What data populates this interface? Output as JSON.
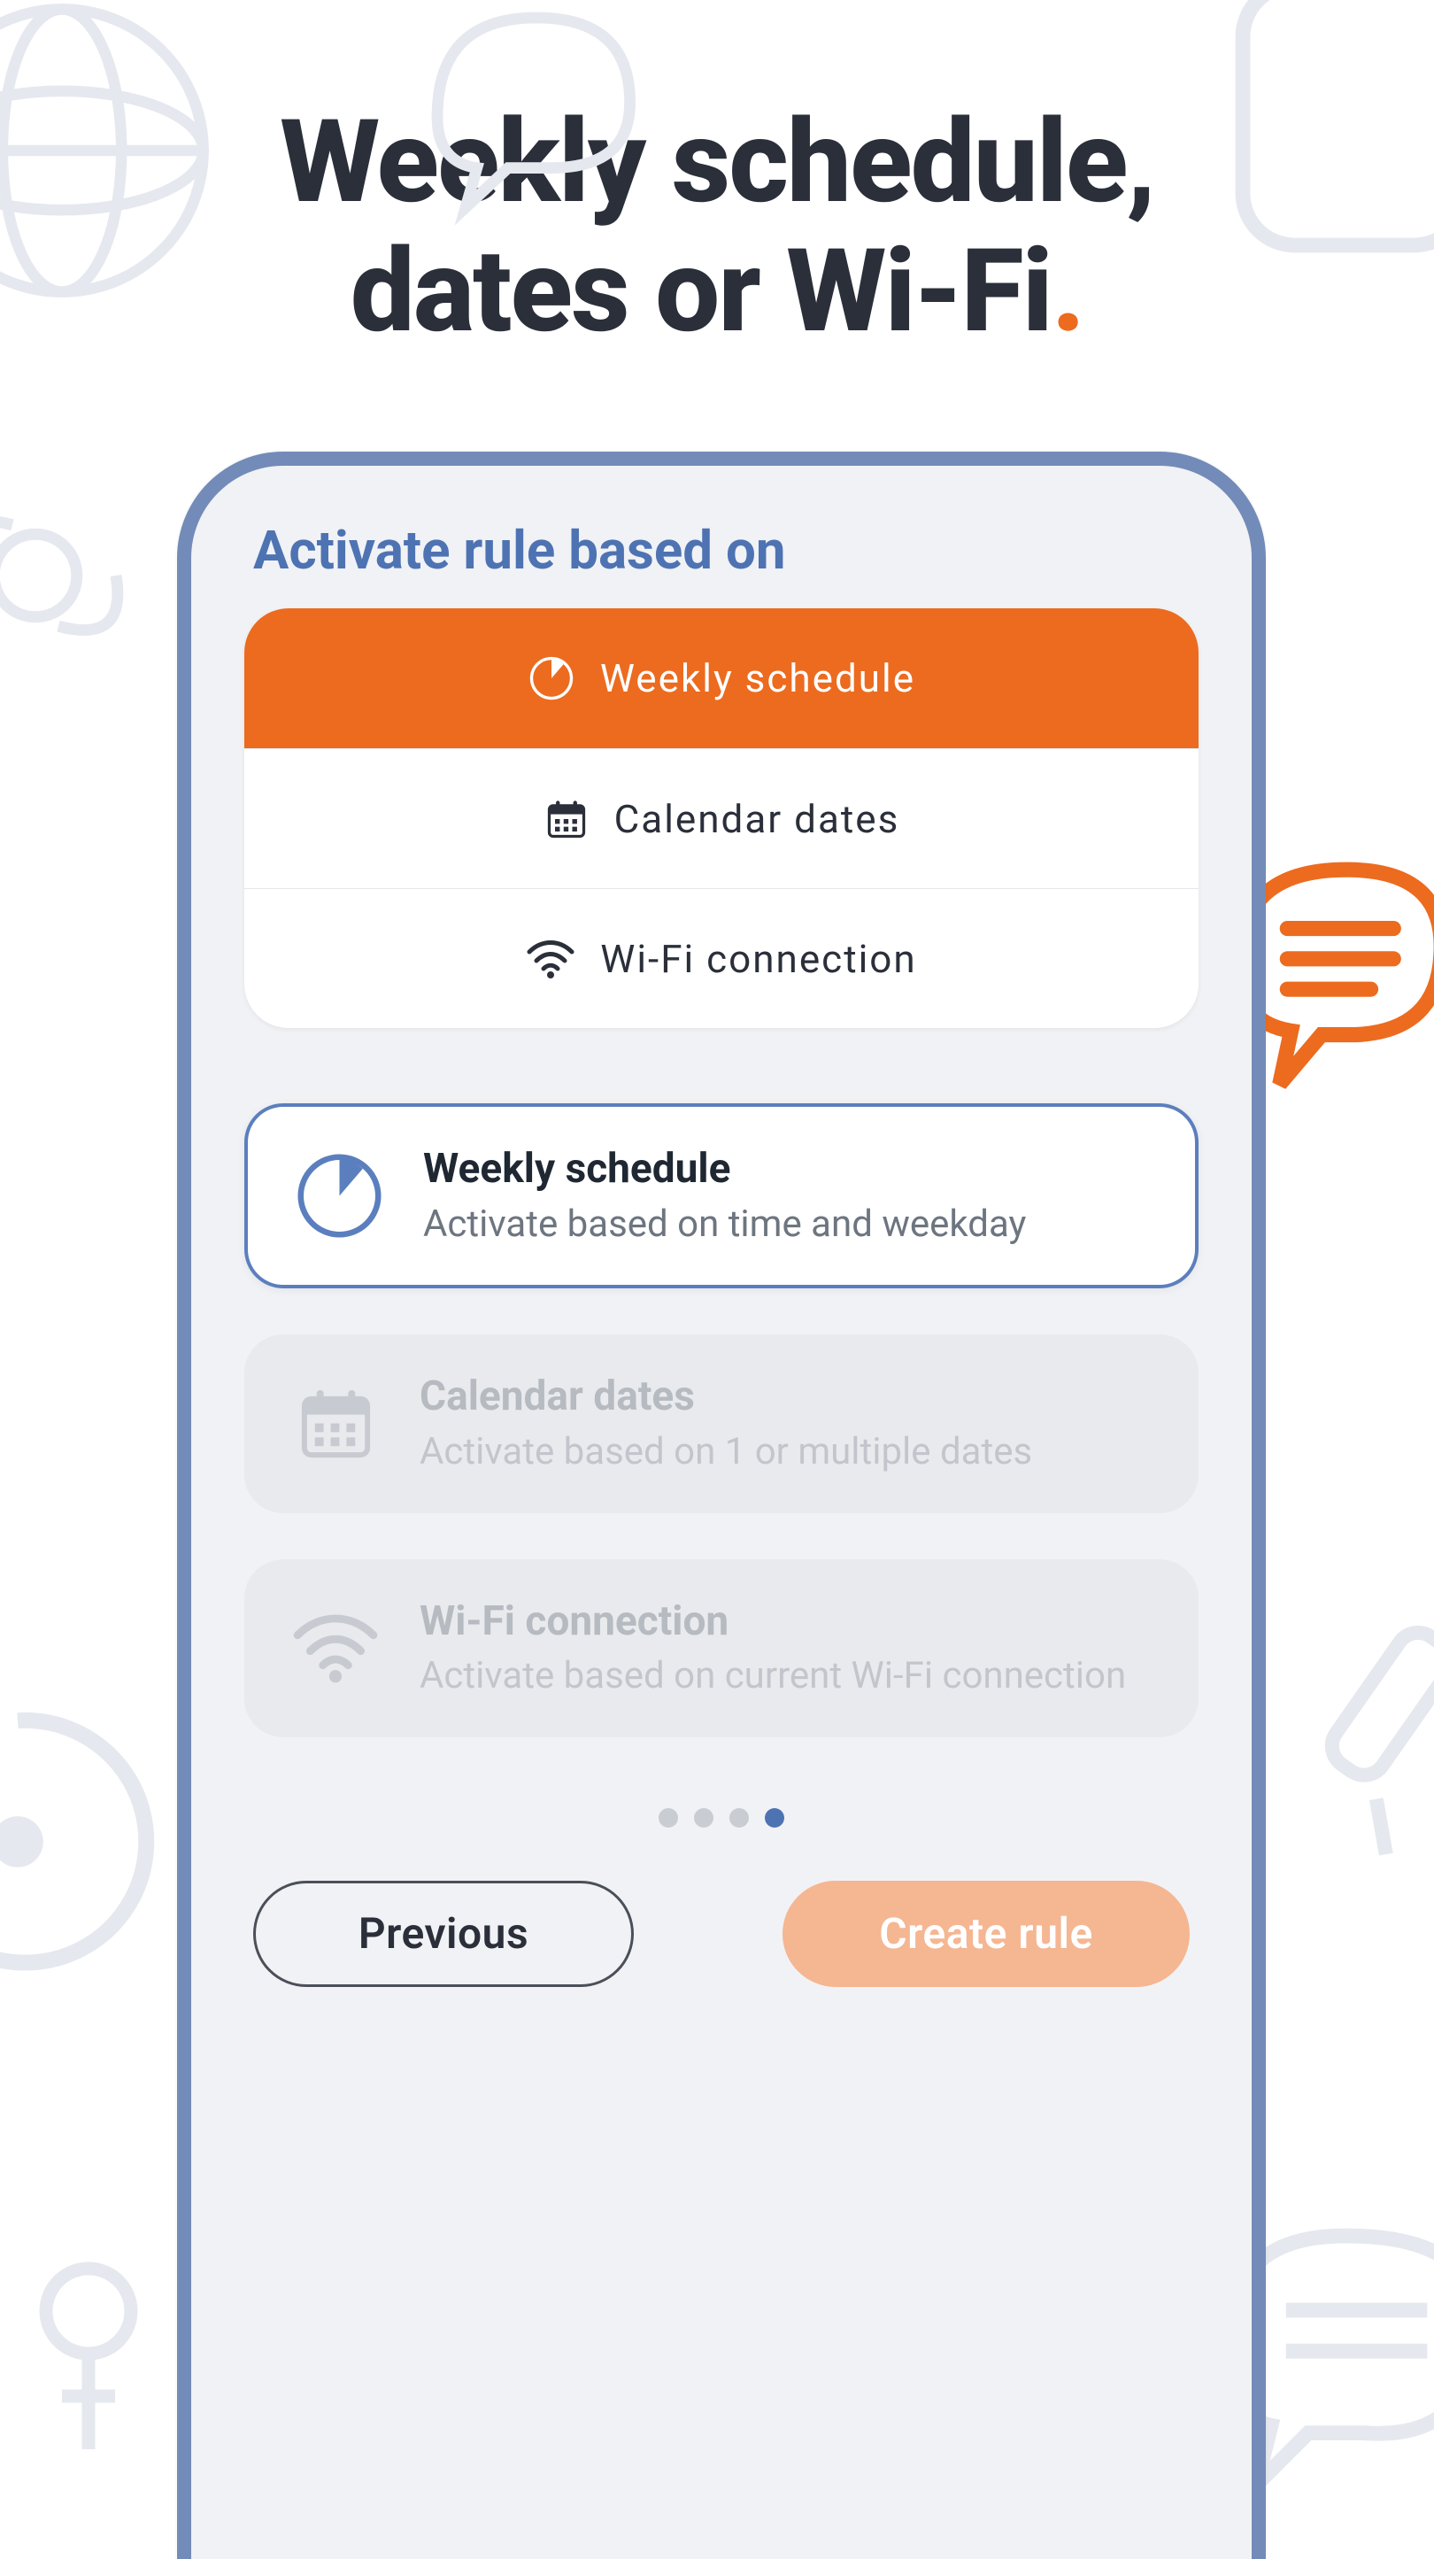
{
  "headline": {
    "line1": "Weekly schedule,",
    "line2": "dates or Wi-Fi"
  },
  "section_title": "Activate rule based on",
  "segmented": [
    {
      "id": "weekly",
      "label": "Weekly schedule",
      "icon": "clock-icon",
      "active": true
    },
    {
      "id": "calendar",
      "label": "Calendar dates",
      "icon": "calendar-icon",
      "active": false
    },
    {
      "id": "wifi",
      "label": "Wi-Fi connection",
      "icon": "wifi-icon",
      "active": false
    }
  ],
  "cards": [
    {
      "id": "weekly",
      "title": "Weekly schedule",
      "desc": "Activate based on time and weekday",
      "icon": "clock-icon",
      "state": "selected"
    },
    {
      "id": "calendar",
      "title": "Calendar dates",
      "desc": "Activate based on 1 or multiple dates",
      "icon": "calendar-icon",
      "state": "muted"
    },
    {
      "id": "wifi",
      "title": "Wi-Fi connection",
      "desc": "Activate based on current Wi-Fi connection",
      "icon": "wifi-icon",
      "state": "muted"
    }
  ],
  "pager": {
    "count": 4,
    "active_index": 3
  },
  "footer": {
    "previous": "Previous",
    "create": "Create rule"
  },
  "colors": {
    "accent": "#ec6b1f",
    "primary_blue": "#4e73b3",
    "frame": "#738bb8"
  }
}
